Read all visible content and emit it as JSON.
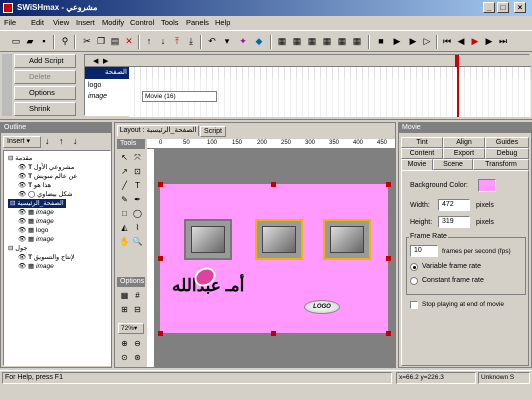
{
  "app": {
    "title": "SWiSHmax - مشروعي"
  },
  "menu": [
    "File",
    "Edit",
    "View",
    "Insert",
    "Modify",
    "Control",
    "Tools",
    "Panels",
    "Help"
  ],
  "left_buttons": {
    "add_script": "Add Script",
    "delete": "Delete",
    "options": "Options",
    "shrink": "Shrink"
  },
  "timeline": {
    "scene_label": "الصفحة",
    "rows": [
      "logo",
      "image"
    ],
    "movie_label": "Movie (16)"
  },
  "outline": {
    "header": "Outline",
    "insert_label": "Insert",
    "items": [
      "مقدمة",
      "مشروعي الأول",
      "عن عالم سويش",
      "هذا هو",
      "شكل بيضاوي",
      "الصفحة_الرئيسية",
      "image",
      "image",
      "logo",
      "image",
      "جول",
      "لإنتاج والتسويق",
      "image"
    ]
  },
  "stage": {
    "tab_layout": "Layout : الصفحة_الرئيسية",
    "tab_script": "Script",
    "tools_label": "Tools",
    "options_label": "Options",
    "ruler": [
      "0",
      "50",
      "100",
      "150",
      "200",
      "250",
      "300",
      "350",
      "400",
      "450"
    ],
    "zoom": "72%",
    "logo_text": "LOGO",
    "watermark": "أمـ عبدالله"
  },
  "movie_panel": {
    "header": "Movie",
    "tabs_row1": [
      "Tint",
      "Align",
      "Guides"
    ],
    "tabs_row2": [
      "Content",
      "Export",
      "Debug"
    ],
    "tabs_row3": [
      "Movie",
      "Scene",
      "Transform"
    ],
    "bg_color_label": "Background Color:",
    "bg_color": "#ff99ff",
    "width_label": "Width:",
    "width_value": "472",
    "height_label": "Height:",
    "height_value": "319",
    "pixels": "pixels",
    "frame_rate_label": "Frame Rate",
    "fps_value": "10",
    "fps_label": "frames per second (fps)",
    "variable_label": "Variable frame rate",
    "constant_label": "Constant frame rate",
    "stop_label": "Stop playing at end of movie"
  },
  "status": {
    "help": "For Help, press F1",
    "coords": "x=66.2 y=226.3",
    "unknown": "Unknown S"
  }
}
